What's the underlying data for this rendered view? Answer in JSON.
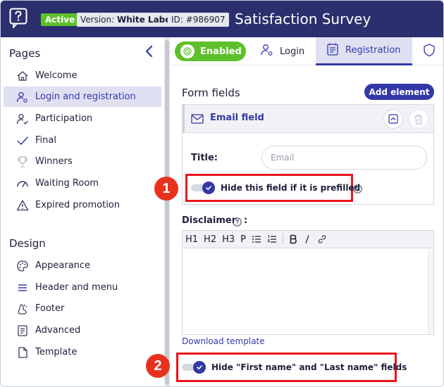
{
  "header": {
    "status_badge": "Active",
    "version_prefix": "Version: ",
    "version_value": "White Label",
    "id_label": "ID: #986907",
    "title": "Satisfaction Survey"
  },
  "sidebar": {
    "pages_title": "Pages",
    "pages": [
      {
        "label": "Welcome",
        "icon": "home-icon"
      },
      {
        "label": "Login and registration",
        "icon": "user-key-icon",
        "active": true
      },
      {
        "label": "Participation",
        "icon": "user-check-icon"
      },
      {
        "label": "Final",
        "icon": "check-icon"
      },
      {
        "label": "Winners",
        "icon": "trophy-icon"
      },
      {
        "label": "Waiting Room",
        "icon": "gauge-icon"
      },
      {
        "label": "Expired promotion",
        "icon": "warning-icon"
      }
    ],
    "design_title": "Design",
    "design": [
      {
        "label": "Appearance",
        "icon": "palette-icon"
      },
      {
        "label": "Header and menu",
        "icon": "menu-icon"
      },
      {
        "label": "Footer",
        "icon": "foot-icon"
      },
      {
        "label": "Advanced",
        "icon": "document-code-icon"
      },
      {
        "label": "Template",
        "icon": "file-icon"
      }
    ]
  },
  "tabs": {
    "enabled_label": "Enabled",
    "login_label": "Login",
    "registration_label": "Registration"
  },
  "form": {
    "section_title": "Form fields",
    "add_element_label": "Add element",
    "field": {
      "name": "Email field",
      "title_label": "Title:",
      "title_placeholder": "Email",
      "hide_prefilled_label": "Hide this field if it is prefilled"
    },
    "disclaimer_label": "Disclaimer",
    "disclaimer_colon": ":",
    "toolbar": [
      "H1",
      "H2",
      "H3",
      "P"
    ],
    "download_template_label": "Download template",
    "hide_names_label": "Hide \"First name\" and \"Last name\" fields"
  },
  "callouts": [
    "1",
    "2"
  ],
  "colors": {
    "header_bg": "#2b2f6e",
    "accent": "#3338a8",
    "success": "#5ec02a",
    "highlight": "#e8141c",
    "callout": "#e8311c"
  }
}
